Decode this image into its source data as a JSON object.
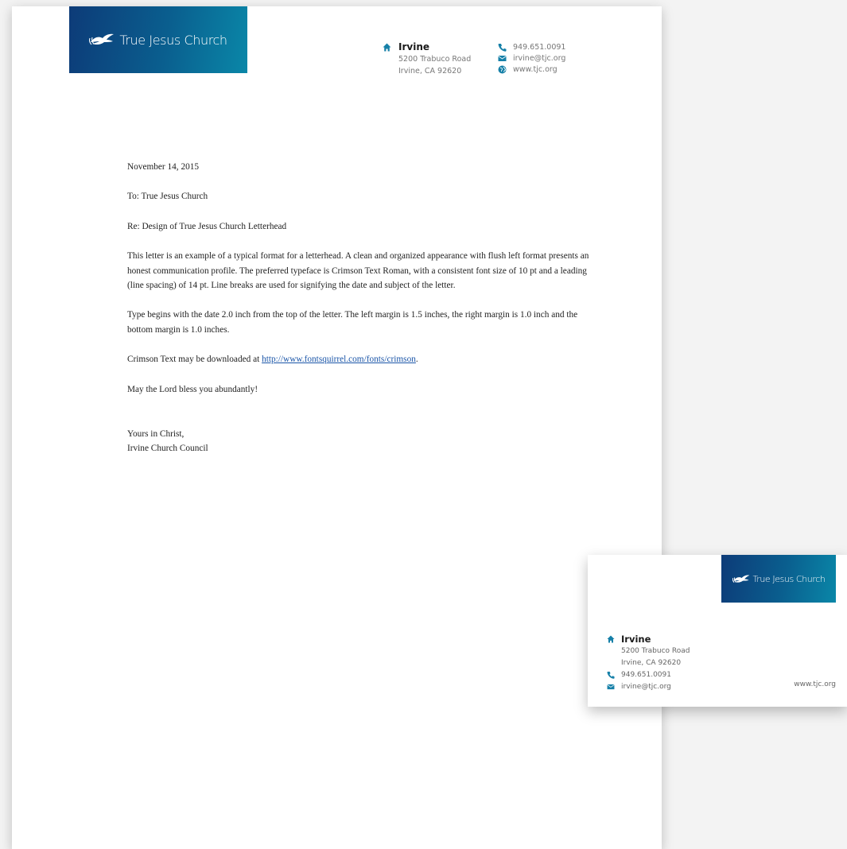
{
  "brand": {
    "name": "True Jesus Church",
    "color_dark": "#0d3b78",
    "color_light": "#0a87a8",
    "icon": "dove-icon"
  },
  "contact": {
    "location": "Irvine",
    "address_line1": "5200 Trabuco Road",
    "address_line2": "Irvine, CA 92620",
    "phone": "949.651.0091",
    "email": "irvine@tjc.org",
    "website": "www.tjc.org",
    "icon_color": "#1680a8"
  },
  "letter": {
    "date": "November 14, 2015",
    "to": "To: True Jesus Church",
    "re": "Re: Design of True Jesus Church Letterhead",
    "para1": "This letter is an example of a typical format for a letterhead. A clean and organized appearance with flush left format presents an honest communication profile. The preferred typeface is Crimson Text Roman, with a consistent font size of 10 pt and a leading (line spacing) of 14 pt. Line breaks are used for signifying the date and subject of the letter.",
    "para2": "Type begins with the date 2.0 inch from the top of the letter. The left margin is 1.5 inches, the right margin is 1.0 inch and the bottom margin is 1.0 inches.",
    "para3_prefix": "Crimson Text may be downloaded at ",
    "para3_link": "http://www.fontsquirrel.com/fonts/crimson",
    "para3_suffix": ".",
    "para4": "May the Lord bless you abundantly!",
    "closing": "Yours in Christ,",
    "signature": "Irvine Church Council"
  }
}
